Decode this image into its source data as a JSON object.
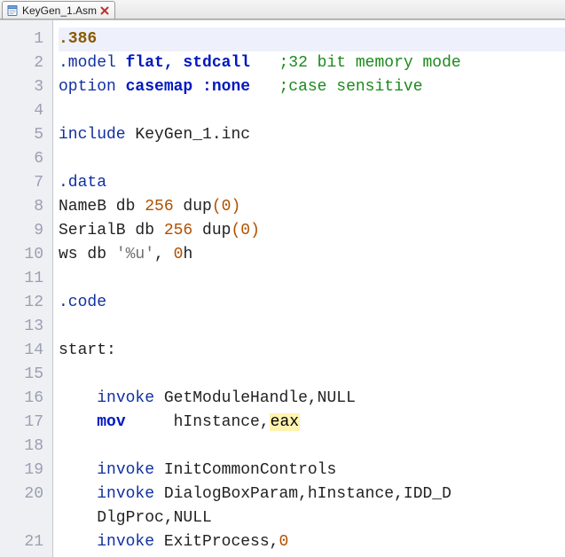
{
  "tab": {
    "filename": "KeyGen_1.Asm"
  },
  "code": {
    "lines": [
      {
        "n": 1,
        "current": true,
        "tokens": [
          [
            ".386",
            "dir"
          ]
        ]
      },
      {
        "n": 2,
        "tokens": [
          [
            ".model ",
            "dot"
          ],
          [
            "flat, stdcall",
            "kw"
          ],
          [
            "   ;32 bit memory mode",
            "cmt"
          ]
        ]
      },
      {
        "n": 3,
        "tokens": [
          [
            "option ",
            "inst"
          ],
          [
            "casemap :none",
            "kw"
          ],
          [
            "   ;case sensitive",
            "cmt"
          ]
        ]
      },
      {
        "n": 4,
        "tokens": [
          [
            "",
            "id"
          ]
        ]
      },
      {
        "n": 5,
        "tokens": [
          [
            "include ",
            "inst"
          ],
          [
            "KeyGen_1.inc",
            "id"
          ]
        ]
      },
      {
        "n": 6,
        "tokens": [
          [
            "",
            "id"
          ]
        ]
      },
      {
        "n": 7,
        "tokens": [
          [
            ".data",
            "dot"
          ]
        ]
      },
      {
        "n": 8,
        "tokens": [
          [
            "NameB db ",
            "id"
          ],
          [
            "256",
            "num"
          ],
          [
            " dup",
            "id"
          ],
          [
            "(",
            "punc"
          ],
          [
            "0",
            "num"
          ],
          [
            ")",
            "punc"
          ]
        ]
      },
      {
        "n": 9,
        "tokens": [
          [
            "SerialB db ",
            "id"
          ],
          [
            "256",
            "num"
          ],
          [
            " dup",
            "id"
          ],
          [
            "(",
            "punc"
          ],
          [
            "0",
            "num"
          ],
          [
            ")",
            "punc"
          ]
        ]
      },
      {
        "n": 10,
        "tokens": [
          [
            "ws db ",
            "id"
          ],
          [
            "'%u'",
            "str"
          ],
          [
            ", ",
            "id"
          ],
          [
            "0",
            "num"
          ],
          [
            "h",
            "id"
          ]
        ]
      },
      {
        "n": 11,
        "tokens": [
          [
            "",
            "id"
          ]
        ]
      },
      {
        "n": 12,
        "tokens": [
          [
            ".code",
            "dot"
          ]
        ]
      },
      {
        "n": 13,
        "tokens": [
          [
            "",
            "id"
          ]
        ]
      },
      {
        "n": 14,
        "tokens": [
          [
            "start:",
            "id"
          ]
        ]
      },
      {
        "n": 15,
        "tokens": [
          [
            "",
            "id"
          ]
        ]
      },
      {
        "n": 16,
        "tokens": [
          [
            "    ",
            "id"
          ],
          [
            "invoke ",
            "inst"
          ],
          [
            "GetModuleHandle,NULL",
            "id"
          ]
        ]
      },
      {
        "n": 17,
        "tokens": [
          [
            "    ",
            "id"
          ],
          [
            "mov",
            "kw"
          ],
          [
            "     hInstance,",
            "id"
          ],
          [
            "eax",
            "hl"
          ]
        ]
      },
      {
        "n": 18,
        "tokens": [
          [
            "",
            "id"
          ]
        ]
      },
      {
        "n": 19,
        "tokens": [
          [
            "    ",
            "id"
          ],
          [
            "invoke ",
            "inst"
          ],
          [
            "InitCommonControls",
            "id"
          ]
        ]
      },
      {
        "n": 20,
        "tokens": [
          [
            "    ",
            "id"
          ],
          [
            "invoke ",
            "inst"
          ],
          [
            "DialogBoxParam,hInstance,IDD_D",
            "id"
          ]
        ]
      },
      {
        "n": 20,
        "wrap": true,
        "tokens": [
          [
            "    DlgProc,NULL",
            "id"
          ]
        ]
      },
      {
        "n": 21,
        "tokens": [
          [
            "    ",
            "id"
          ],
          [
            "invoke ",
            "inst"
          ],
          [
            "ExitProcess,",
            "id"
          ],
          [
            "0",
            "num"
          ]
        ]
      }
    ]
  }
}
